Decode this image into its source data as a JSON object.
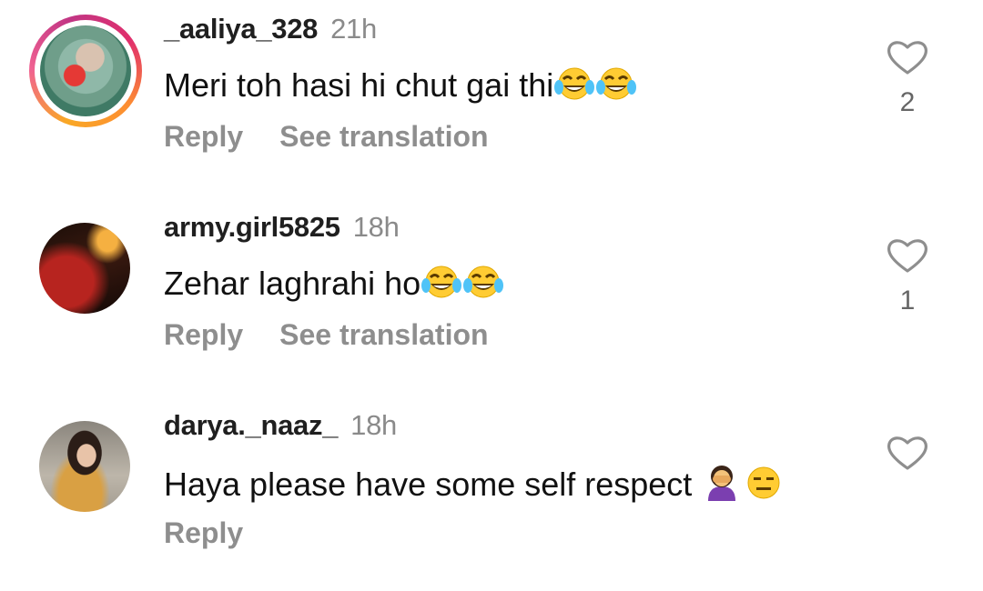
{
  "comments": [
    {
      "username": "_aaliya_328",
      "time": "21h",
      "text": "Meri toh hasi hi chut gai thi",
      "emojis": [
        "face-with-tears-of-joy",
        "face-with-tears-of-joy"
      ],
      "reply_label": "Reply",
      "translate_label": "See translation",
      "likes": "2",
      "has_story_ring": true
    },
    {
      "username": "army.girl5825",
      "time": "18h",
      "text": "Zehar laghrahi ho",
      "emojis": [
        "face-with-tears-of-joy",
        "face-with-tears-of-joy"
      ],
      "reply_label": "Reply",
      "translate_label": "See translation",
      "likes": "1",
      "has_story_ring": false
    },
    {
      "username": "darya._naaz_",
      "time": "18h",
      "text": "Haya please have some self respect ",
      "emojis": [
        "woman-facepalming",
        "expressionless-face"
      ],
      "reply_label": "Reply",
      "likes": "",
      "has_story_ring": false
    }
  ],
  "colors": {
    "username": "#1f1f1f",
    "meta": "#8e8e8e",
    "heart_outline": "#8e8e8e",
    "emoji_yellow": "#ffcc33"
  }
}
